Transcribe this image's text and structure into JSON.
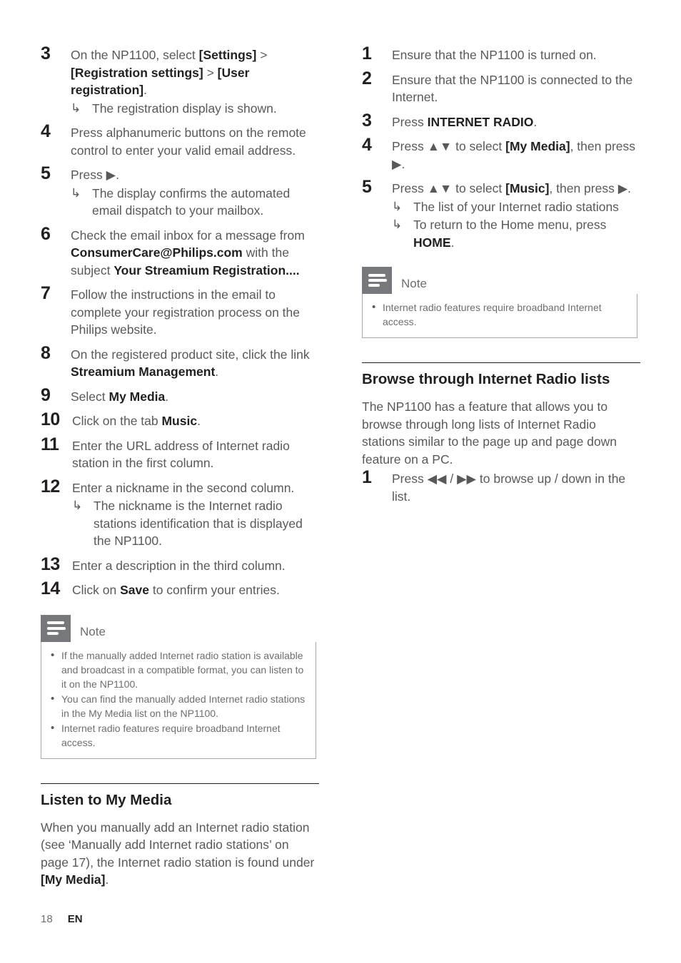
{
  "page": {
    "number": "18",
    "language": "EN"
  },
  "left_column": {
    "steps": [
      {
        "num": "3",
        "segments": [
          {
            "t": "On the NP1100, select ",
            "b": false
          },
          {
            "t": "[Settings]",
            "b": true
          },
          {
            "t": " > ",
            "b": false
          },
          {
            "t": "[Registration settings]",
            "b": true
          },
          {
            "t": " > ",
            "b": false
          },
          {
            "t": "[User registration]",
            "b": true
          },
          {
            "t": ".",
            "b": false
          }
        ],
        "substeps": [
          {
            "arrow": "↳",
            "text": "The registration display is shown."
          }
        ]
      },
      {
        "num": "4",
        "segments": [
          {
            "t": "Press alphanumeric buttons on the remote control to enter your valid email address.",
            "b": false
          }
        ],
        "substeps": []
      },
      {
        "num": "5",
        "segments": [
          {
            "t": "Press ",
            "b": false
          },
          {
            "t": "▶",
            "b": false
          },
          {
            "t": ".",
            "b": false
          }
        ],
        "substeps": [
          {
            "arrow": "↳",
            "text": "The display confirms the automated email dispatch to your mailbox."
          }
        ]
      },
      {
        "num": "6",
        "segments": [
          {
            "t": "Check the email inbox for a message from ",
            "b": false
          },
          {
            "t": "ConsumerCare@Philips.com",
            "b": true
          },
          {
            "t": " with the subject ",
            "b": false
          },
          {
            "t": "Your Streamium Registration....",
            "b": true
          }
        ],
        "substeps": []
      },
      {
        "num": "7",
        "segments": [
          {
            "t": "Follow the instructions in the email to complete your registration process on the Philips website.",
            "b": false
          }
        ],
        "substeps": []
      },
      {
        "num": "8",
        "segments": [
          {
            "t": "On the registered product site, click the link ",
            "b": false
          },
          {
            "t": "Streamium Management",
            "b": true
          },
          {
            "t": ".",
            "b": false
          }
        ],
        "substeps": []
      },
      {
        "num": "9",
        "segments": [
          {
            "t": "Select ",
            "b": false
          },
          {
            "t": "My Media",
            "b": true
          },
          {
            "t": ".",
            "b": false
          }
        ],
        "substeps": []
      },
      {
        "num": "10",
        "segments": [
          {
            "t": "Click on the tab ",
            "b": false
          },
          {
            "t": "Music",
            "b": true
          },
          {
            "t": ".",
            "b": false
          }
        ],
        "substeps": []
      },
      {
        "num": "11",
        "segments": [
          {
            "t": "Enter the URL address of Internet radio station in the first column.",
            "b": false
          }
        ],
        "substeps": []
      },
      {
        "num": "12",
        "segments": [
          {
            "t": "Enter a nickname in the second column.",
            "b": false
          }
        ],
        "substeps": [
          {
            "arrow": "↳",
            "text": "The nickname is the Internet radio stations identification that is displayed the NP1100."
          }
        ]
      },
      {
        "num": "13",
        "segments": [
          {
            "t": "Enter a description in the third column.",
            "b": false
          }
        ],
        "substeps": []
      },
      {
        "num": "14",
        "segments": [
          {
            "t": "Click on ",
            "b": false
          },
          {
            "t": "Save",
            "b": true
          },
          {
            "t": " to confirm your entries.",
            "b": false
          }
        ],
        "substeps": []
      }
    ],
    "note": {
      "title": "Note",
      "bullet": "•",
      "items": [
        "If the manually added Internet radio station is available and broadcast in a compatible format, you can listen to it on the NP1100.",
        "You can find the manually added Internet radio stations in the My Media list on the NP1100.",
        "Internet radio features require broadband Internet access."
      ]
    },
    "section": {
      "title": "Listen to My Media",
      "paragraph_segments": [
        {
          "t": "When you manually add an Internet radio station (see ‘Manually add Internet radio stations’ on page 17), the Internet radio station is found under ",
          "b": false
        },
        {
          "t": "[My Media]",
          "b": true
        },
        {
          "t": ".",
          "b": false
        }
      ]
    }
  },
  "right_column": {
    "steps": [
      {
        "num": "1",
        "segments": [
          {
            "t": "Ensure that the NP1100 is turned on.",
            "b": false
          }
        ],
        "substeps": []
      },
      {
        "num": "2",
        "segments": [
          {
            "t": "Ensure that the NP1100 is connected to the Internet.",
            "b": false
          }
        ],
        "substeps": []
      },
      {
        "num": "3",
        "segments": [
          {
            "t": "Press ",
            "b": false
          },
          {
            "t": "INTERNET RADIO",
            "b": true
          },
          {
            "t": ".",
            "b": false
          }
        ],
        "substeps": []
      },
      {
        "num": "4",
        "segments": [
          {
            "t": "Press ▲▼ to select ",
            "b": false
          },
          {
            "t": "[My Media]",
            "b": true
          },
          {
            "t": ", then press ▶.",
            "b": false
          }
        ],
        "substeps": []
      },
      {
        "num": "5",
        "segments": [
          {
            "t": "Press ▲▼ to select ",
            "b": false
          },
          {
            "t": "[Music]",
            "b": true
          },
          {
            "t": ", then press ▶.",
            "b": false
          }
        ],
        "substeps": [
          {
            "arrow": "↳",
            "text": "The list of your Internet radio stations"
          },
          {
            "arrow": "↳",
            "text": "To return to the Home menu, press HOME.",
            "bold_tail": "HOME"
          }
        ]
      }
    ],
    "note": {
      "title": "Note",
      "bullet": "•",
      "items": [
        "Internet radio features require broadband Internet access."
      ]
    },
    "section": {
      "title": "Browse through Internet Radio lists",
      "paragraph_segments": [
        {
          "t": "The NP1100 has a feature that allows you to browse through long lists of Internet Radio stations similar to the page up and page down feature on a PC.",
          "b": false
        }
      ],
      "steps": [
        {
          "num": "1",
          "segments": [
            {
              "t": "Press ◀◀ / ▶▶ to browse up / down in the list.",
              "b": false
            }
          ],
          "substeps": []
        }
      ]
    }
  }
}
